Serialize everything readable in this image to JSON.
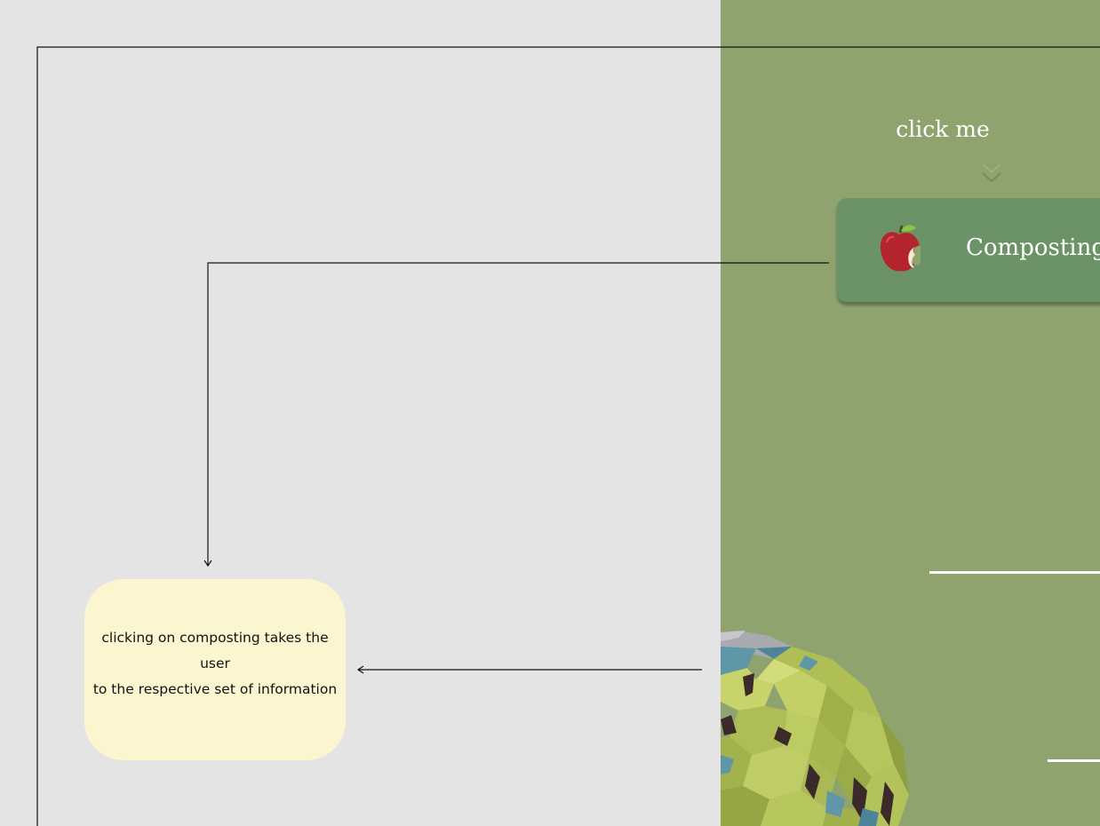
{
  "prototype": {
    "hint_text": "click me",
    "hint_icon": "double-chevron-down-icon",
    "card": {
      "label": "Composting",
      "icon": "apple-icon"
    },
    "decoration": "low-poly-globe-icon"
  },
  "annotation": {
    "lines": [
      "clicking on composting takes the",
      "user",
      "to the respective set of information"
    ]
  },
  "colors": {
    "canvas": "#e4e4e4",
    "panel": "#8fa36f",
    "card": "#6b9367",
    "note": "#fbf6cf",
    "connector": "#111111"
  }
}
